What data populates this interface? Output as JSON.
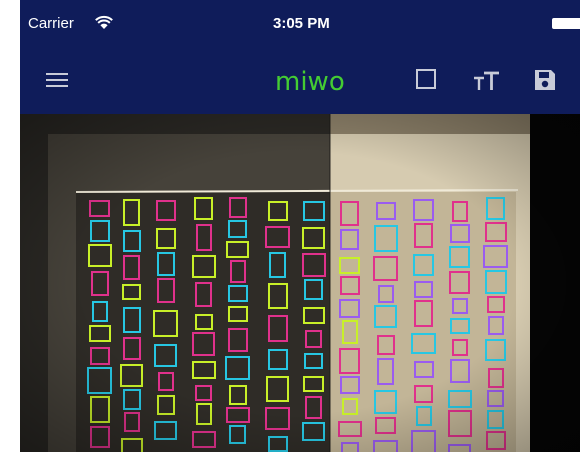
{
  "status_bar": {
    "carrier": "Carrier",
    "time": "3:05 PM",
    "wifi_icon": "wifi-icon",
    "battery_icon": "battery-icon"
  },
  "nav": {
    "title": "miwo",
    "menu_icon": "hamburger-menu-icon",
    "box_icon": "square-outline-icon",
    "text_size_icon": "text-size-icon",
    "save_icon": "save-floppy-icon"
  },
  "colors": {
    "nav_background": "#0f1c5a",
    "title": "#44cc33",
    "box_pink": "#e0318c",
    "box_yellow_green": "#c8f028",
    "box_cyan": "#27c7e3",
    "box_purple": "#9a5cf0"
  }
}
